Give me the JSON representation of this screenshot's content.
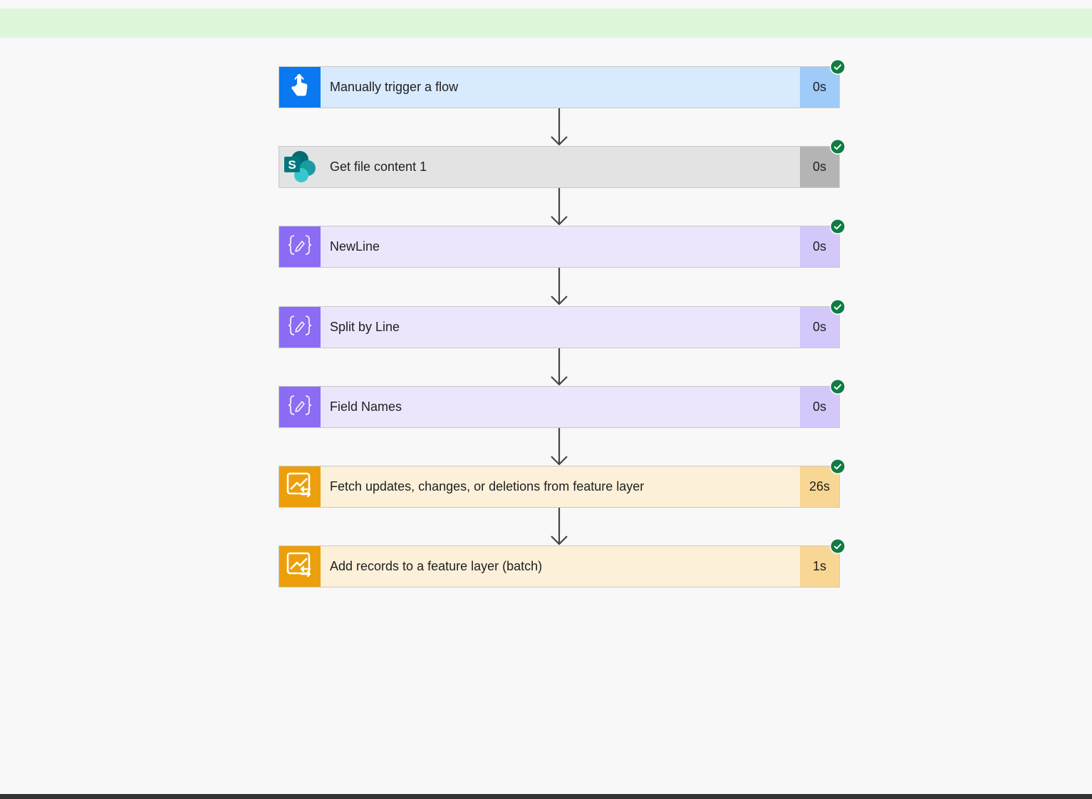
{
  "steps": [
    {
      "title": "Manually trigger a flow",
      "duration": "0s",
      "icon": "touch-trigger-icon",
      "bg": "#d8eafd",
      "icon_bg": "#0a78f0",
      "duration_bg": "#9ecbf8"
    },
    {
      "title": "Get file content 1",
      "duration": "0s",
      "icon": "sharepoint-icon",
      "bg": "#e3e3e3",
      "icon_bg": "#e3e3e3",
      "duration_bg": "#b4b4b4"
    },
    {
      "title": "NewLine",
      "duration": "0s",
      "icon": "variable-icon",
      "bg": "#ece6fc",
      "icon_bg": "#8c6cf5",
      "duration_bg": "#d4c8fb"
    },
    {
      "title": "Split by Line",
      "duration": "0s",
      "icon": "variable-icon",
      "bg": "#ece6fc",
      "icon_bg": "#8c6cf5",
      "duration_bg": "#d4c8fb"
    },
    {
      "title": "Field Names",
      "duration": "0s",
      "icon": "variable-icon",
      "bg": "#ece6fc",
      "icon_bg": "#8c6cf5",
      "duration_bg": "#d4c8fb"
    },
    {
      "title": "Fetch updates, changes, or deletions from feature layer",
      "duration": "26s",
      "icon": "arcgis-icon",
      "bg": "#fcf0d9",
      "icon_bg": "#ec9f0a",
      "duration_bg": "#f8d795"
    },
    {
      "title": "Add records to a feature layer (batch)",
      "duration": "1s",
      "icon": "arcgis-icon",
      "bg": "#fcf0d9",
      "icon_bg": "#ec9f0a",
      "duration_bg": "#f8d795"
    }
  ],
  "colors": {
    "success": "#107c41",
    "banner": "#dff6dd"
  }
}
